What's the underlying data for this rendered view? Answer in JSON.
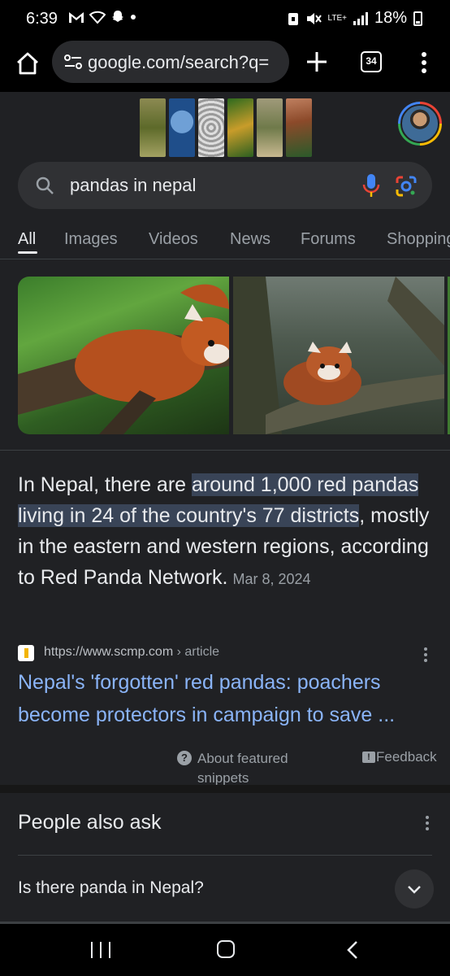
{
  "status_bar": {
    "time": "6:39",
    "network": "LTE+",
    "battery": "18%"
  },
  "browser": {
    "url": "google.com/search?q=",
    "tab_count": "34"
  },
  "search": {
    "query": "pandas in nepal"
  },
  "tabs": [
    "All",
    "Images",
    "Videos",
    "News",
    "Forums",
    "Shopping"
  ],
  "active_tab": "All",
  "snippet": {
    "before": "In Nepal, there are ",
    "highlight": "around 1,000 red pandas living in 24 of the country's 77 districts",
    "after": ", mostly in the eastern and western regions, according to Red Panda Network.",
    "date": "Mar 8, 2024"
  },
  "source": {
    "url": "https://www.scmp.com",
    "path": "› article",
    "title": "Nepal's 'forgotten' red pandas: poachers become protectors in campaign to save ..."
  },
  "footer_links": {
    "about": "About featured snippets",
    "feedback": "Feedback"
  },
  "people_also_ask": {
    "title": "People also ask",
    "questions": [
      "Is there panda in Nepal?"
    ]
  },
  "colors": {
    "page_bg": "#202124",
    "link": "#8ab4f8",
    "highlight": "#394457"
  }
}
